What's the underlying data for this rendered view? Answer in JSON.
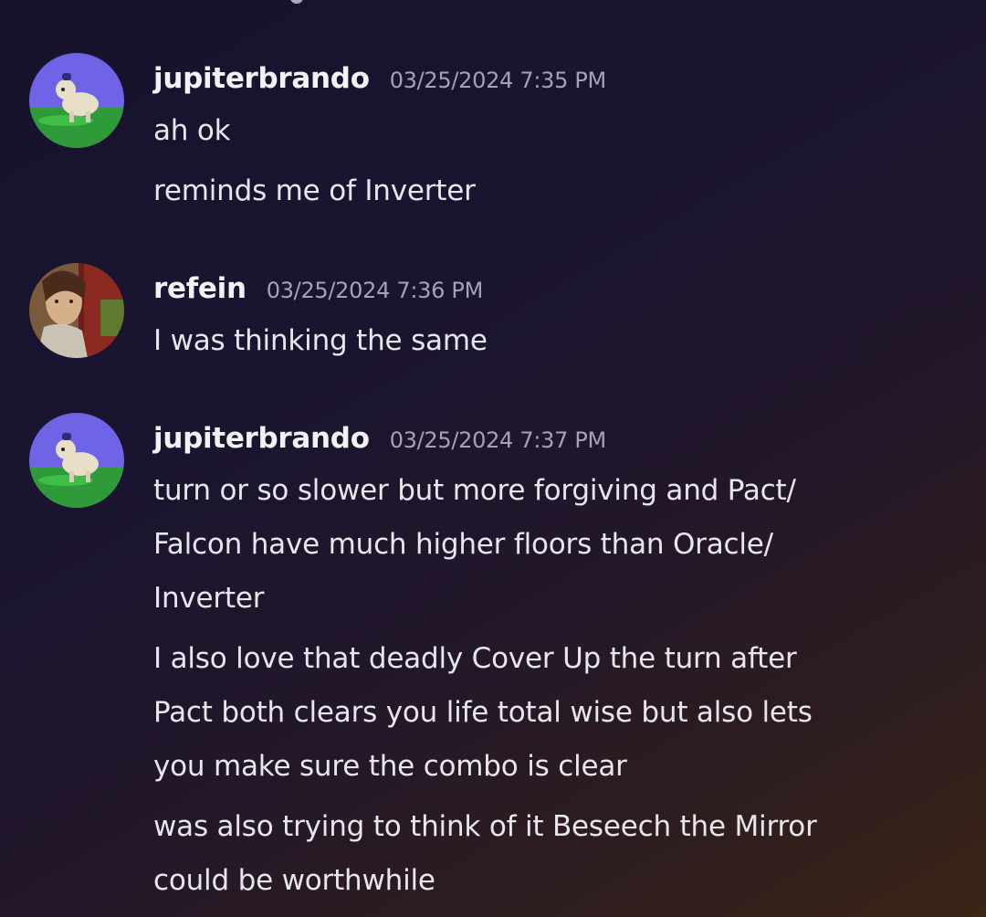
{
  "messages": [
    {
      "username": "jupiterbrando",
      "timestamp": "03/25/2024 7:35 PM",
      "avatar_icon": "dog-character-avatar-icon",
      "lines": [
        "ah ok",
        "reminds me of Inverter"
      ]
    },
    {
      "username": "refein",
      "timestamp": "03/25/2024 7:36 PM",
      "avatar_icon": "portrait-avatar-icon",
      "lines": [
        "I was thinking the same"
      ]
    },
    {
      "username": "jupiterbrando",
      "timestamp": "03/25/2024 7:37 PM",
      "avatar_icon": "dog-character-avatar-icon",
      "lines": [
        "turn or so slower but more forgiving and Pact/",
        "Falcon have much higher floors than Oracle/",
        "Inverter",
        "I also love that deadly Cover Up the turn after",
        "Pact both clears you life total wise but also lets",
        "you make sure the combo is clear",
        "was also trying to think of it Beseech the Mirror",
        "could be worthwhile"
      ]
    }
  ],
  "colors": {
    "username": "#f2f2f5",
    "timestamp": "#a3a3b4",
    "message_text": "#e6e6ec"
  }
}
